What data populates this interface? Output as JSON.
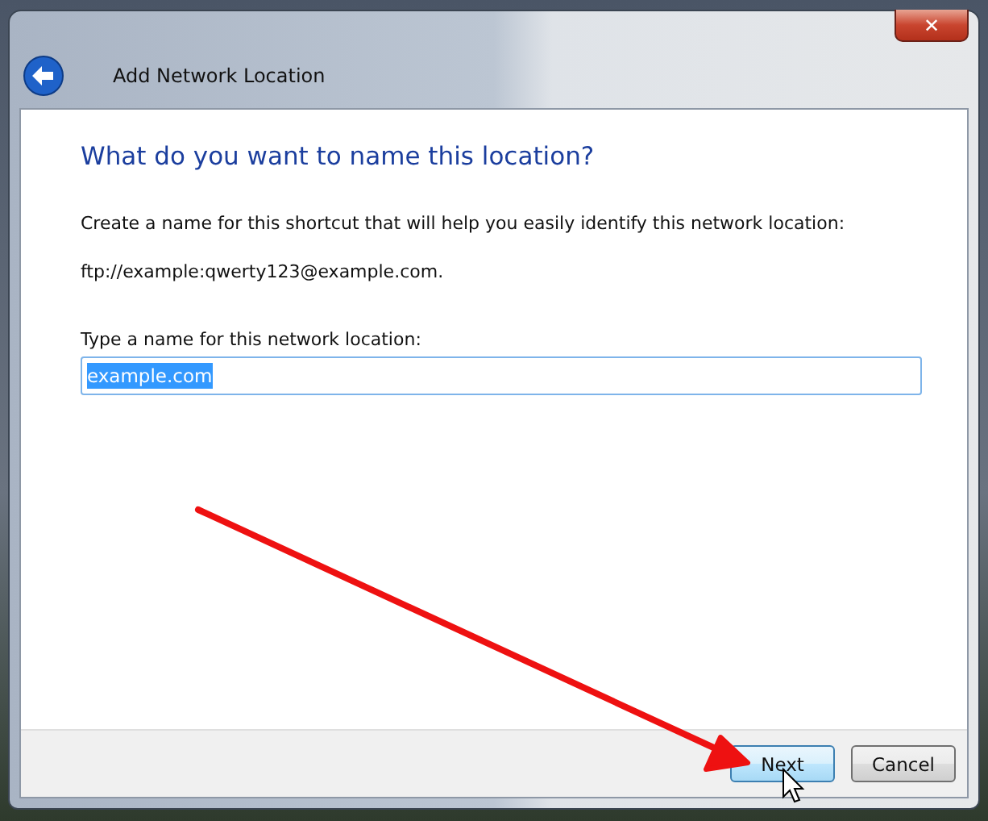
{
  "window": {
    "title": "Add Network Location",
    "close_label": "✕"
  },
  "heading": "What do you want to name this location?",
  "description": "Create a name for this shortcut that will help you easily identify this network location:",
  "address": "ftp://example:qwerty123@example.com.",
  "name_field": {
    "label": "Type a name for this network location:",
    "value": "example.com",
    "text_selected": true
  },
  "buttons": [
    {
      "label": "Next",
      "highlighted": true
    },
    {
      "label": "Cancel",
      "highlighted": false
    }
  ]
}
